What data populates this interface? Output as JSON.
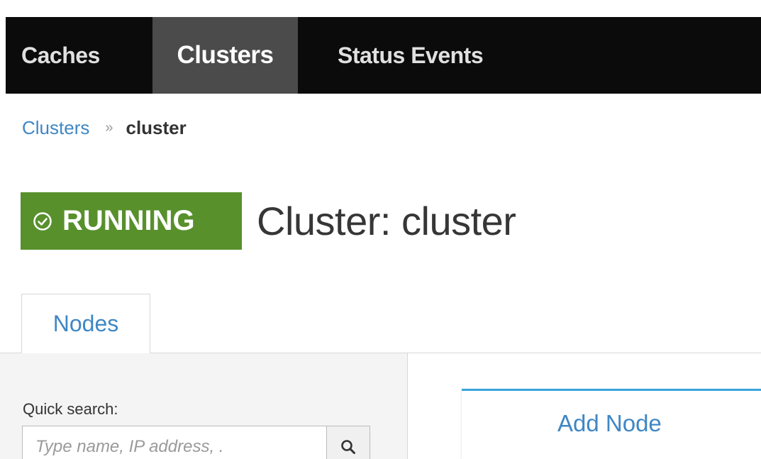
{
  "navbar": {
    "tabs": [
      {
        "label": "Caches",
        "active": false
      },
      {
        "label": "Clusters",
        "active": true
      },
      {
        "label": "Status Events",
        "active": false
      }
    ]
  },
  "breadcrumb": {
    "parent": "Clusters",
    "separator": "»",
    "current": "cluster"
  },
  "status": {
    "label": "RUNNING",
    "icon": "check-circle-icon",
    "color": "#58902c"
  },
  "page": {
    "title": "Cluster: cluster"
  },
  "tabs": [
    {
      "label": "Nodes",
      "active": true
    }
  ],
  "search": {
    "label": "Quick search:",
    "placeholder": "Type name, IP address, .",
    "value": "",
    "button_icon": "search-icon"
  },
  "actions": {
    "add_node_label": "Add Node"
  },
  "colors": {
    "navbar_bg": "#0b0b0b",
    "active_tab_bg": "#4b4b4b",
    "link": "#3f87c4",
    "card_accent": "#39a5dc"
  }
}
